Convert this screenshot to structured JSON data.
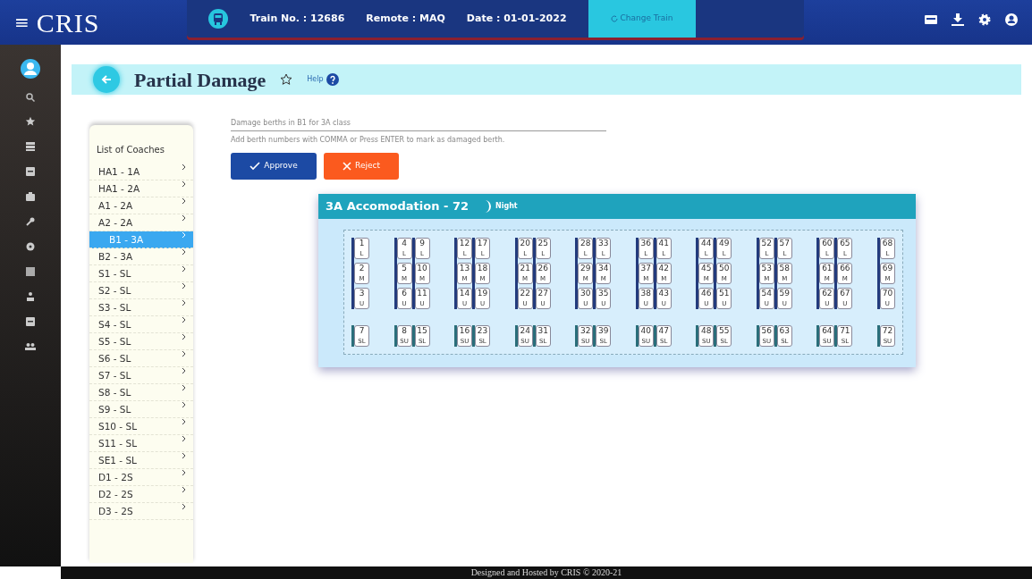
{
  "app": {
    "menu_glyph": "≡",
    "logo": "CRIS"
  },
  "train_bar": {
    "train_no": "Train No. : 12686",
    "remote": "Remote : MAQ",
    "date": "Date : 01-01-2022",
    "change_button": "Change Train"
  },
  "page": {
    "title": "Partial Damage",
    "help": "Help"
  },
  "coach_list": {
    "heading": "List of Coaches",
    "items": [
      {
        "label": "HA1 - 1A",
        "selected": false
      },
      {
        "label": "HA1 - 2A",
        "selected": false
      },
      {
        "label": "A1 - 2A",
        "selected": false
      },
      {
        "label": "A2 - 2A",
        "selected": false
      },
      {
        "label": "B1 - 3A",
        "selected": true
      },
      {
        "label": "B2 - 3A",
        "selected": false
      },
      {
        "label": "S1 - SL",
        "selected": false
      },
      {
        "label": "S2 - SL",
        "selected": false
      },
      {
        "label": "S3 - SL",
        "selected": false
      },
      {
        "label": "S4 - SL",
        "selected": false
      },
      {
        "label": "S5 - SL",
        "selected": false
      },
      {
        "label": "S6 - SL",
        "selected": false
      },
      {
        "label": "S7 - SL",
        "selected": false
      },
      {
        "label": "S8 - SL",
        "selected": false
      },
      {
        "label": "S9 - SL",
        "selected": false
      },
      {
        "label": "S10 - SL",
        "selected": false
      },
      {
        "label": "S11 - SL",
        "selected": false
      },
      {
        "label": "SE1 - SL",
        "selected": false
      },
      {
        "label": "D1 - 2S",
        "selected": false
      },
      {
        "label": "D2 - 2S",
        "selected": false
      },
      {
        "label": "D3 - 2S",
        "selected": false
      }
    ]
  },
  "form": {
    "placeholder": "Damage berths in B1 for 3A class",
    "hint": "Add berth numbers with COMMA or Press ENTER to mark as damaged berth.",
    "approve": "Approve",
    "reject": "Reject"
  },
  "layout": {
    "title": "3A Accomodation - 72",
    "mode": "Night",
    "bays": [
      {
        "main": [
          [
            {
              "number": "1",
              "type": "L"
            },
            {
              "number": "2",
              "type": "M"
            },
            {
              "number": "3",
              "type": "U"
            }
          ]
        ],
        "side": [
          {
            "number": "7",
            "type": "SL"
          }
        ]
      },
      {
        "main": [
          [
            {
              "number": "4",
              "type": "L"
            },
            {
              "number": "5",
              "type": "M"
            },
            {
              "number": "6",
              "type": "U"
            }
          ],
          [
            {
              "number": "9",
              "type": "L"
            },
            {
              "number": "10",
              "type": "M"
            },
            {
              "number": "11",
              "type": "U"
            }
          ]
        ],
        "side": [
          {
            "number": "8",
            "type": "SU"
          },
          {
            "number": "15",
            "type": "SL"
          }
        ]
      },
      {
        "main": [
          [
            {
              "number": "12",
              "type": "L"
            },
            {
              "number": "13",
              "type": "M"
            },
            {
              "number": "14",
              "type": "U"
            }
          ],
          [
            {
              "number": "17",
              "type": "L"
            },
            {
              "number": "18",
              "type": "M"
            },
            {
              "number": "19",
              "type": "U"
            }
          ]
        ],
        "side": [
          {
            "number": "16",
            "type": "SU"
          },
          {
            "number": "23",
            "type": "SL"
          }
        ]
      },
      {
        "main": [
          [
            {
              "number": "20",
              "type": "L"
            },
            {
              "number": "21",
              "type": "M"
            },
            {
              "number": "22",
              "type": "U"
            }
          ],
          [
            {
              "number": "25",
              "type": "L"
            },
            {
              "number": "26",
              "type": "M"
            },
            {
              "number": "27",
              "type": "U"
            }
          ]
        ],
        "side": [
          {
            "number": "24",
            "type": "SU"
          },
          {
            "number": "31",
            "type": "SL"
          }
        ]
      },
      {
        "main": [
          [
            {
              "number": "28",
              "type": "L"
            },
            {
              "number": "29",
              "type": "M"
            },
            {
              "number": "30",
              "type": "U"
            }
          ],
          [
            {
              "number": "33",
              "type": "L"
            },
            {
              "number": "34",
              "type": "M"
            },
            {
              "number": "35",
              "type": "U"
            }
          ]
        ],
        "side": [
          {
            "number": "32",
            "type": "SU"
          },
          {
            "number": "39",
            "type": "SL"
          }
        ]
      },
      {
        "main": [
          [
            {
              "number": "36",
              "type": "L"
            },
            {
              "number": "37",
              "type": "M"
            },
            {
              "number": "38",
              "type": "U"
            }
          ],
          [
            {
              "number": "41",
              "type": "L"
            },
            {
              "number": "42",
              "type": "M"
            },
            {
              "number": "43",
              "type": "U"
            }
          ]
        ],
        "side": [
          {
            "number": "40",
            "type": "SU"
          },
          {
            "number": "47",
            "type": "SL"
          }
        ]
      },
      {
        "main": [
          [
            {
              "number": "44",
              "type": "L"
            },
            {
              "number": "45",
              "type": "M"
            },
            {
              "number": "46",
              "type": "U"
            }
          ],
          [
            {
              "number": "49",
              "type": "L"
            },
            {
              "number": "50",
              "type": "M"
            },
            {
              "number": "51",
              "type": "U"
            }
          ]
        ],
        "side": [
          {
            "number": "48",
            "type": "SU"
          },
          {
            "number": "55",
            "type": "SL"
          }
        ]
      },
      {
        "main": [
          [
            {
              "number": "52",
              "type": "L"
            },
            {
              "number": "53",
              "type": "M"
            },
            {
              "number": "54",
              "type": "U"
            }
          ],
          [
            {
              "number": "57",
              "type": "L"
            },
            {
              "number": "58",
              "type": "M"
            },
            {
              "number": "59",
              "type": "U"
            }
          ]
        ],
        "side": [
          {
            "number": "56",
            "type": "SU"
          },
          {
            "number": "63",
            "type": "SL"
          }
        ]
      },
      {
        "main": [
          [
            {
              "number": "60",
              "type": "L"
            },
            {
              "number": "61",
              "type": "M"
            },
            {
              "number": "62",
              "type": "U"
            }
          ],
          [
            {
              "number": "65",
              "type": "L"
            },
            {
              "number": "66",
              "type": "M"
            },
            {
              "number": "67",
              "type": "U"
            }
          ]
        ],
        "side": [
          {
            "number": "64",
            "type": "SU"
          },
          {
            "number": "71",
            "type": "SL"
          }
        ]
      },
      {
        "main": [
          [
            {
              "number": "68",
              "type": "L"
            },
            {
              "number": "69",
              "type": "M"
            },
            {
              "number": "70",
              "type": "U"
            }
          ]
        ],
        "side": [
          {
            "number": "72",
            "type": "SU"
          }
        ]
      }
    ]
  },
  "footer": "Designed and Hosted by CRIS © 2020-21"
}
